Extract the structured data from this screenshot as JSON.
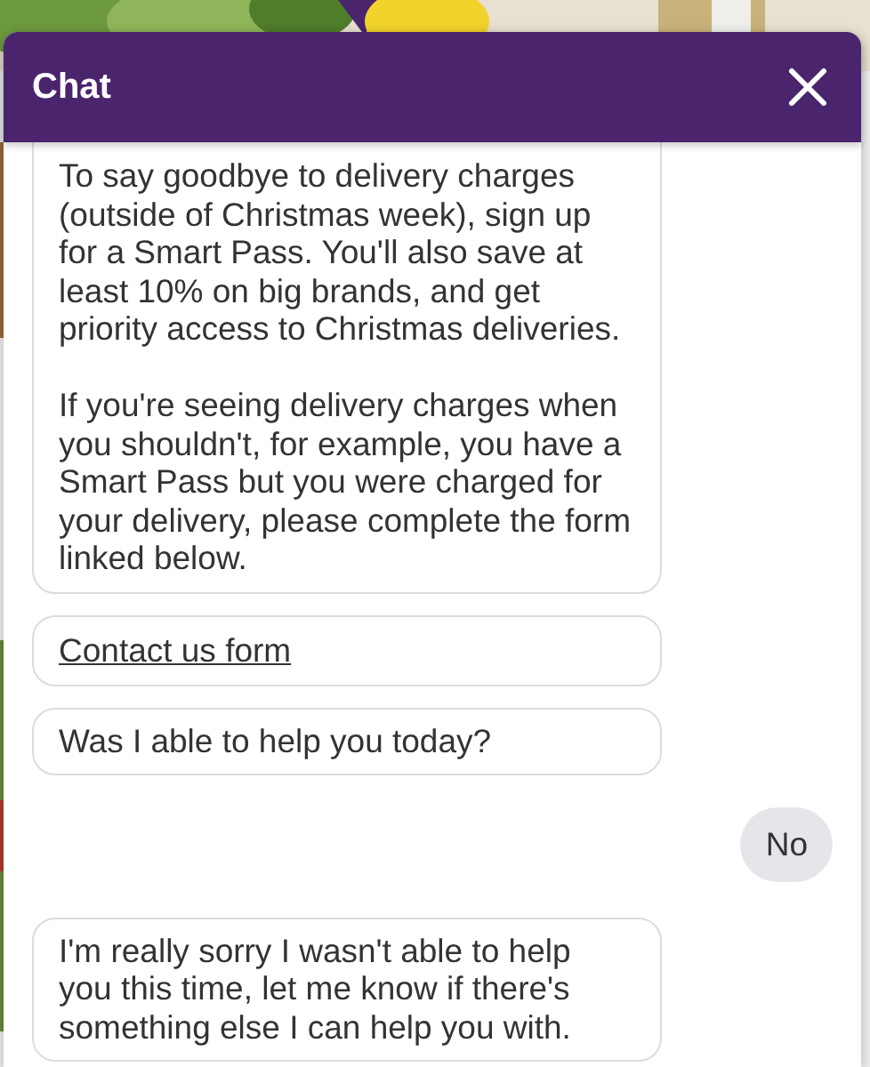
{
  "chat": {
    "title": "Chat",
    "messages": [
      {
        "kind": "bot",
        "paragraphs": [
          "To say goodbye to delivery charges (outside of Christmas week), sign up for a Smart Pass. You'll also save at least 10% on big brands, and get priority access to Christmas deliveries.",
          "If you're seeing delivery charges when you shouldn't, for example, you have a Smart Pass but you were charged for your delivery, please complete the form linked below."
        ]
      },
      {
        "kind": "link",
        "text": "Contact us form"
      },
      {
        "kind": "bot",
        "paragraphs": [
          "Was I able to help you today?"
        ]
      },
      {
        "kind": "user",
        "paragraphs": [
          "No"
        ]
      },
      {
        "kind": "bot",
        "paragraphs": [
          "I'm really sorry I wasn't able to help you this time, let me know if there's something else I can help you with."
        ]
      }
    ]
  }
}
